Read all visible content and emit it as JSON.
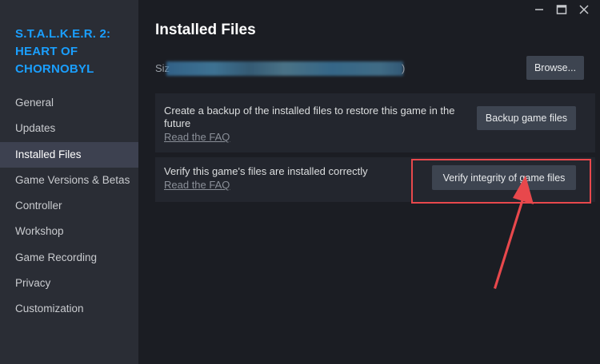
{
  "sidebar": {
    "game_title": "S.T.A.L.K.E.R. 2: HEART OF CHORNOBYL",
    "items": [
      {
        "label": "General"
      },
      {
        "label": "Updates"
      },
      {
        "label": "Installed Files",
        "active": true
      },
      {
        "label": "Game Versions & Betas"
      },
      {
        "label": "Controller"
      },
      {
        "label": "Workshop"
      },
      {
        "label": "Game Recording"
      },
      {
        "label": "Privacy"
      },
      {
        "label": "Customization"
      }
    ]
  },
  "main": {
    "title": "Installed Files",
    "size_label": "Siz",
    "size_tail": ")",
    "browse_label": "Browse...",
    "backup_panel": {
      "text": "Create a backup of the installed files to restore this game in the future",
      "link": "Read the FAQ",
      "button": "Backup game files"
    },
    "verify_panel": {
      "text": "Verify this game's files are installed correctly",
      "link": "Read the FAQ",
      "button": "Verify integrity of game files"
    }
  },
  "colors": {
    "accent": "#1a9fff",
    "highlight": "#e8484c",
    "sidebar_bg": "#2a2d35",
    "main_bg": "#1b1d23"
  },
  "icons": {
    "minimize": "minimize-icon",
    "maximize": "maximize-icon",
    "close": "close-icon",
    "annotation": "red-arrow-icon"
  }
}
